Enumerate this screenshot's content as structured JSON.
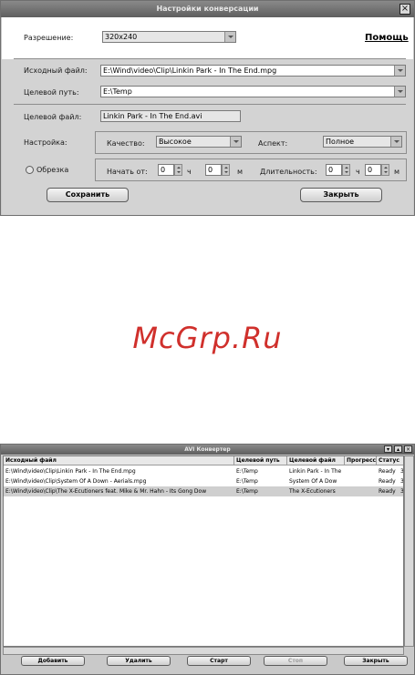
{
  "dialog": {
    "title": "Настройки конверсации",
    "resolution_label": "Разрешение:",
    "resolution_value": "320x240",
    "help_link": "Помощь",
    "source_file_label": "Исходный файл:",
    "source_file_value": "E:\\Wind\\video\\Clip\\Linkin Park - In The End.mpg",
    "target_path_label": "Целевой путь:",
    "target_path_value": "E:\\Temp",
    "target_file_label": "Целевой файл:",
    "target_file_value": "Linkin Park - In The End.avi",
    "settings_label": "Настройка:",
    "quality_label": "Качество:",
    "quality_value": "Высокое",
    "aspect_label": "Аспект:",
    "aspect_value": "Полное",
    "trim_label": "Обрезка",
    "start_label": "Начать от:",
    "start_hours": "0",
    "hours_unit": "ч",
    "start_minutes": "0",
    "minutes_unit": "м",
    "duration_label": "Длительность:",
    "duration_hours": "0",
    "duration_minutes": "0",
    "save_button": "Сохранить",
    "close_button": "Закрыть"
  },
  "watermark": "McGrp.Ru",
  "converter": {
    "title": "AVI Конвертер",
    "columns": [
      "Исходный файл",
      "Целевой путь",
      "Целевой файл",
      "Прогресс",
      "Статус"
    ],
    "rows": [
      {
        "source": "E:\\Wind\\video\\Clip\\Linkin Park - In The End.mpg",
        "path": "E:\\Temp",
        "target": "Linkin Park - In The",
        "progress": "",
        "status": "Ready",
        "extra": "3"
      },
      {
        "source": "E:\\Wind\\video\\Clip\\System Of A Down -  Aerials.mpg",
        "path": "E:\\Temp",
        "target": "System Of A Dow",
        "progress": "",
        "status": "Ready",
        "extra": "3"
      },
      {
        "source": "E:\\Wind\\video\\Clip\\The X-Ecutioners feat. Mike & Mr. Hahn - Its Gong Dow",
        "path": "E:\\Temp",
        "target": "The X-Ecutioners",
        "progress": "",
        "status": "Ready",
        "extra": "3"
      }
    ],
    "buttons": {
      "add": "Добавить",
      "delete": "Удалить",
      "start": "Старт",
      "stop": "Стоп",
      "close": "Закрыть"
    }
  }
}
